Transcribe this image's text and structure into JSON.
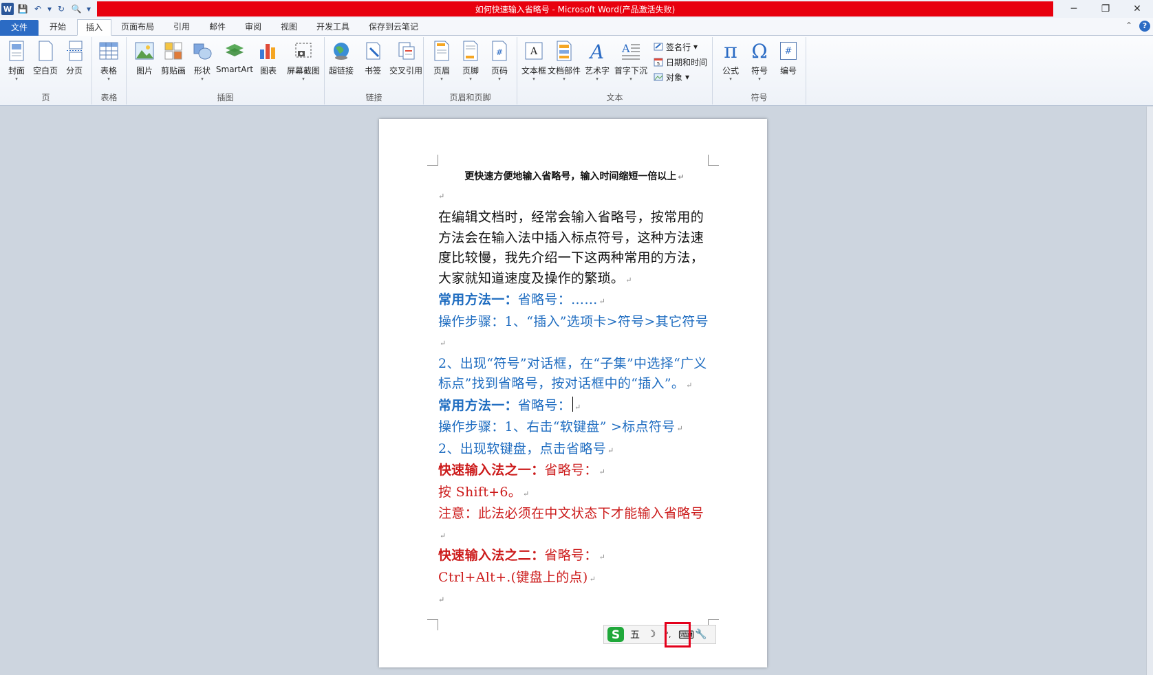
{
  "window": {
    "title": "如何快速输入省略号 - Microsoft Word(产品激活失败)",
    "minimize": "─",
    "restore": "❐",
    "close": "✕"
  },
  "qat": {
    "app_icon": "W",
    "save": "💾",
    "undo": "↶",
    "undo_dd": "▾",
    "redo": "↻",
    "preview": "🔍",
    "customize": "▾"
  },
  "tabs": [
    {
      "label": "文件"
    },
    {
      "label": "开始"
    },
    {
      "label": "插入"
    },
    {
      "label": "页面布局"
    },
    {
      "label": "引用"
    },
    {
      "label": "邮件"
    },
    {
      "label": "审阅"
    },
    {
      "label": "视图"
    },
    {
      "label": "开发工具"
    },
    {
      "label": "保存到云笔记"
    }
  ],
  "ribbon_collapse": "⌃",
  "help": "?",
  "ribbon": {
    "groups": {
      "pages": "页",
      "tables": "表格",
      "illustrations": "插图",
      "links": "链接",
      "header_footer": "页眉和页脚",
      "text": "文本",
      "symbols": "符号"
    },
    "buttons": {
      "cover": "封面",
      "blank_page": "空白页",
      "page_break": "分页",
      "table": "表格",
      "picture": "图片",
      "clipart": "剪贴画",
      "shapes": "形状",
      "smartart": "SmartArt",
      "chart": "图表",
      "screenshot": "屏幕截图",
      "hyperlink": "超链接",
      "bookmark": "书签",
      "cross_ref": "交叉引用",
      "header": "页眉",
      "footer": "页脚",
      "page_number": "页码",
      "textbox": "文本框",
      "quick_parts": "文档部件",
      "wordart": "艺术字",
      "dropcap": "首字下沉",
      "signature": "签名行",
      "datetime": "日期和时间",
      "object": "对象",
      "equation": "公式",
      "symbol": "符号",
      "numbering": "编号"
    },
    "glyphs": {
      "equation": "π",
      "symbol": "Ω",
      "numbering": "#",
      "page_number": "#",
      "wordart": "A",
      "textbox": "A",
      "dd": "▾"
    }
  },
  "document": {
    "heading": "更快速方便地输入省略号，输入时间缩短一倍以上",
    "para_mark": "↵",
    "intro": "在编辑文档时，经常会输入省略号，按常用的方法会在输入法中插入标点符号，这种方法速度比较慢，我先介绍一下这两种常用的方法，大家就知道速度及操作的繁琐。",
    "m1_title": "常用方法一：",
    "m1_rest": "省略号：……",
    "m1_step1": "操作步骤：1、“插入”选项卡>符号>其它符号",
    "m1_step2": "2、出现“符号”对话框，在“子集”中选择“广义标点”找到省略号，按对话框中的“插入”。",
    "m2_title": "常用方法一：",
    "m2_rest": "省略号：",
    "m2_step1": "操作步骤：1、右击“软键盘” >标点符号",
    "m2_step2": "2、出现软键盘，点击省略号",
    "f1_title": "快速输入法之一：",
    "f1_rest": "省略号：",
    "f1_line": "按 Shift+6。",
    "f1_note": "注意：此法必须在中文状态下才能输入省略号",
    "f2_title": "快速输入法之二：",
    "f2_rest": "省略号：",
    "f2_line": "Ctrl+Alt+.(键盘上的点)"
  },
  "ime": {
    "logo": "S",
    "mode": "五",
    "moon": "☽",
    "punct": "°,",
    "keyboard": "⌨",
    "tool": "🔧"
  },
  "colors": {
    "title_red": "#e8000e",
    "file_tab": "#2b6bc4",
    "blue_text": "#1e6cc0",
    "red_text": "#cc1b1b",
    "highlight": "#e3001b"
  }
}
